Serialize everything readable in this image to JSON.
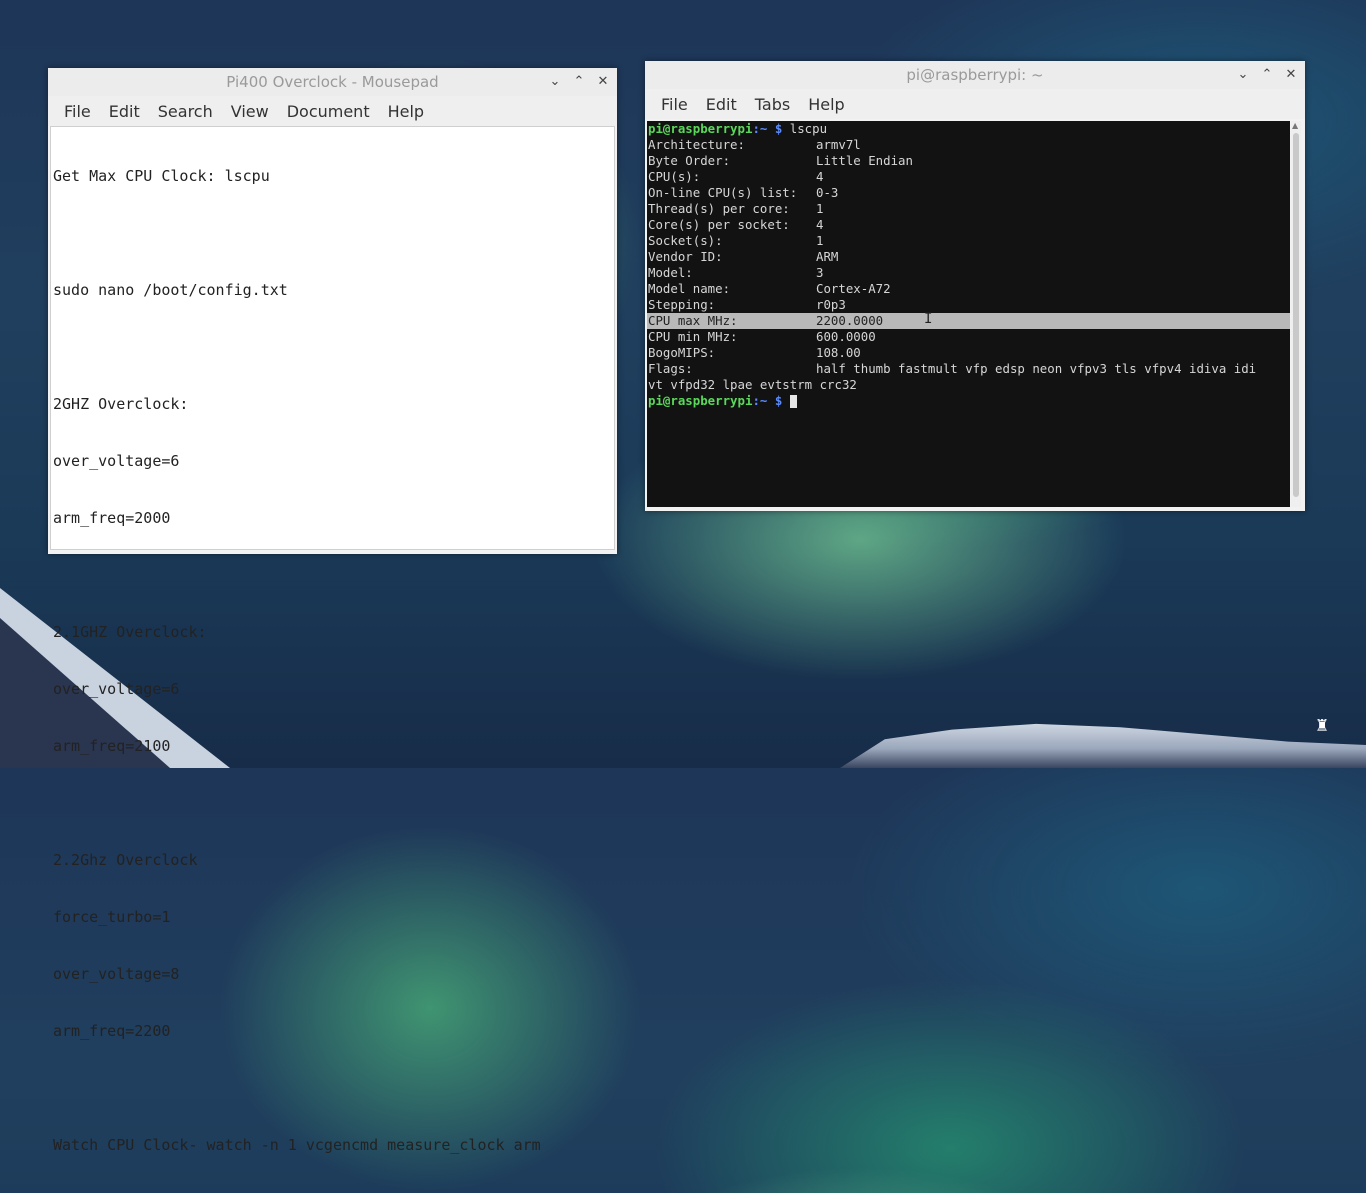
{
  "mousepad": {
    "title": "Pi400 Overclock - Mousepad",
    "menu": [
      "File",
      "Edit",
      "Search",
      "View",
      "Document",
      "Help"
    ],
    "lines": [
      "Get Max CPU Clock: lscpu",
      "",
      "sudo nano /boot/config.txt",
      "",
      "2GHZ Overclock:",
      "over_voltage=6",
      "arm_freq=2000",
      "",
      "2.1GHZ Overclock:",
      "over_voltage=6",
      "arm_freq=2100",
      "",
      "2.2Ghz Overclock",
      "force_turbo=1",
      "over_voltage=8",
      "arm_freq=2200",
      "",
      "Watch CPU Clock- watch -n 1 vcgencmd measure_clock arm"
    ]
  },
  "terminal": {
    "title": "pi@raspberrypi: ~",
    "menu": [
      "File",
      "Edit",
      "Tabs",
      "Help"
    ],
    "prompt_user": "pi@raspberrypi",
    "prompt_path": ":~ $",
    "command": " lscpu",
    "rows": [
      {
        "key": "Architecture:",
        "value": "armv7l"
      },
      {
        "key": "Byte Order:",
        "value": "Little Endian"
      },
      {
        "key": "CPU(s):",
        "value": "4"
      },
      {
        "key": "On-line CPU(s) list:",
        "value": "0-3"
      },
      {
        "key": "Thread(s) per core:",
        "value": "1"
      },
      {
        "key": "Core(s) per socket:",
        "value": "4"
      },
      {
        "key": "Socket(s):",
        "value": "1"
      },
      {
        "key": "Vendor ID:",
        "value": "ARM"
      },
      {
        "key": "Model:",
        "value": "3"
      },
      {
        "key": "Model name:",
        "value": "Cortex-A72"
      },
      {
        "key": "Stepping:",
        "value": "r0p3"
      },
      {
        "key": "CPU max MHz:",
        "value": "2200.0000"
      },
      {
        "key": "CPU min MHz:",
        "value": "600.0000"
      },
      {
        "key": "BogoMIPS:",
        "value": "108.00"
      },
      {
        "key": "Flags:",
        "value": "half thumb fastmult vfp edsp neon vfpv3 tls vfpv4 idiva idi"
      }
    ],
    "flags_wrap": "vt vfpd32 lpae evtstrm crc32"
  },
  "window_buttons": {
    "minimize": "⌄",
    "maximize": "⌃",
    "close": "✕"
  },
  "logo_glyph": "♜"
}
